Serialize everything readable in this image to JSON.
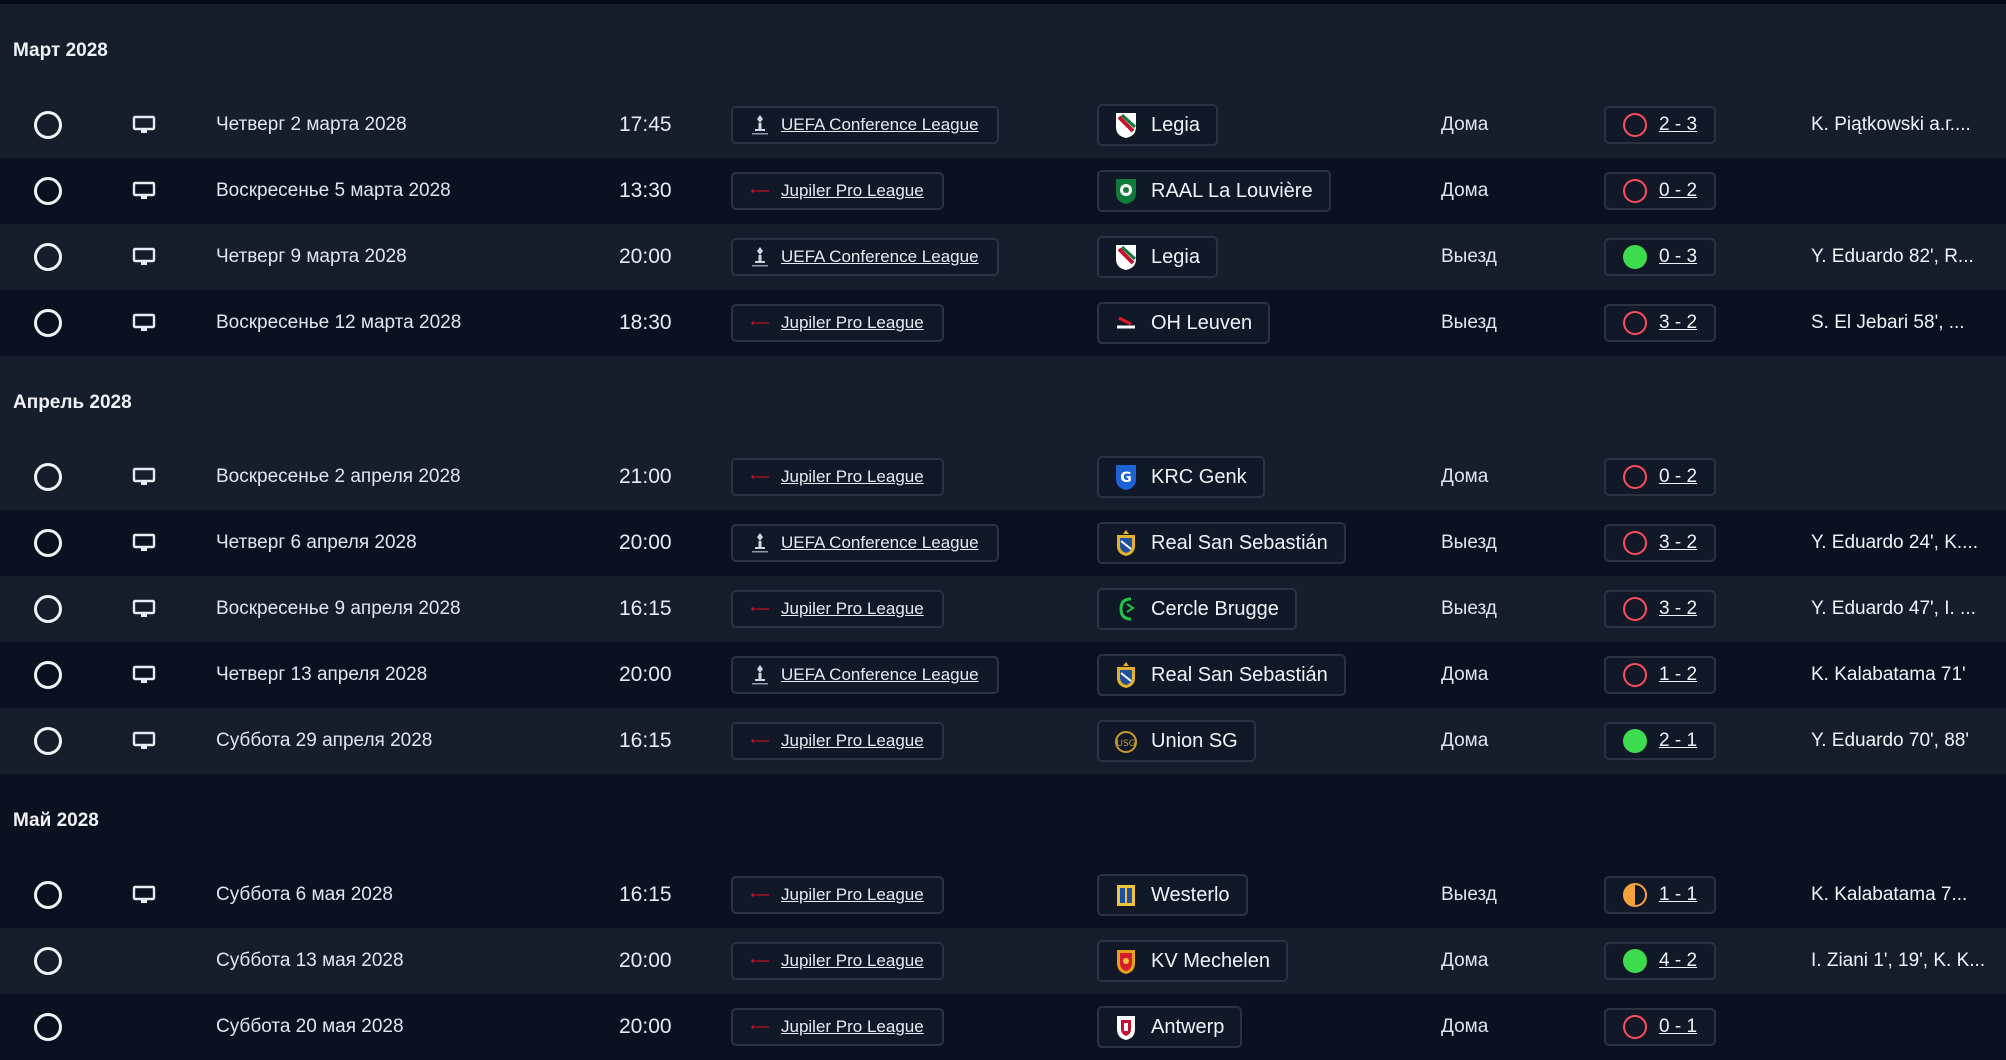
{
  "colors": {
    "win": "#3ddc4f",
    "loss": "#ff4d5e",
    "draw": "#f6a23c",
    "row_dark": "#0b1120",
    "row_light": "#161d2b"
  },
  "months": [
    {
      "title": "Март 2028",
      "matches": [
        {
          "date": "Четверг 2 марта 2028",
          "time": "17:45",
          "competition": "UEFA Conference League",
          "comp_icon": "conference-league-logo-icon",
          "team": "Legia",
          "team_icon": "legia-crest-icon",
          "venue": "Дома",
          "result": "loss",
          "score": "2 - 3",
          "scorers": "K. Piątkowski a.г....",
          "tv": true
        },
        {
          "date": "Воскресенье 5 марта 2028",
          "time": "13:30",
          "competition": "Jupiler Pro League",
          "comp_icon": "jupiler-pro-league-logo-icon",
          "team": "RAAL La Louvière",
          "team_icon": "raal-crest-icon",
          "venue": "Дома",
          "result": "loss",
          "score": "0 - 2",
          "scorers": "",
          "tv": true
        },
        {
          "date": "Четверг 9 марта 2028",
          "time": "20:00",
          "competition": "UEFA Conference League",
          "comp_icon": "conference-league-logo-icon",
          "team": "Legia",
          "team_icon": "legia-crest-icon",
          "venue": "Выезд",
          "result": "win",
          "score": "0 - 3",
          "scorers": "Y. Eduardo 82', R...",
          "tv": true
        },
        {
          "date": "Воскресенье 12 марта 2028",
          "time": "18:30",
          "competition": "Jupiler Pro League",
          "comp_icon": "jupiler-pro-league-logo-icon",
          "team": "OH Leuven",
          "team_icon": "oh-leuven-crest-icon",
          "venue": "Выезд",
          "result": "loss",
          "score": "3 - 2",
          "scorers": "S. El Jebari 58', ...",
          "tv": true
        }
      ]
    },
    {
      "title": "Апрель 2028",
      "matches": [
        {
          "date": "Воскресенье 2 апреля 2028",
          "time": "21:00",
          "competition": "Jupiler Pro League",
          "comp_icon": "jupiler-pro-league-logo-icon",
          "team": "KRC Genk",
          "team_icon": "krc-genk-crest-icon",
          "venue": "Дома",
          "result": "loss",
          "score": "0 - 2",
          "scorers": "",
          "tv": true
        },
        {
          "date": "Четверг 6 апреля 2028",
          "time": "20:00",
          "competition": "UEFA Conference League",
          "comp_icon": "conference-league-logo-icon",
          "team": "Real San Sebastián",
          "team_icon": "real-san-sebastian-crest-icon",
          "venue": "Выезд",
          "result": "loss",
          "score": "3 - 2",
          "scorers": "Y. Eduardo 24', K....",
          "tv": true
        },
        {
          "date": "Воскресенье 9 апреля 2028",
          "time": "16:15",
          "competition": "Jupiler Pro League",
          "comp_icon": "jupiler-pro-league-logo-icon",
          "team": "Cercle Brugge",
          "team_icon": "cercle-brugge-crest-icon",
          "venue": "Выезд",
          "result": "loss",
          "score": "3 - 2",
          "scorers": "Y. Eduardo 47', I. ...",
          "tv": true
        },
        {
          "date": "Четверг 13 апреля 2028",
          "time": "20:00",
          "competition": "UEFA Conference League",
          "comp_icon": "conference-league-logo-icon",
          "team": "Real San Sebastián",
          "team_icon": "real-san-sebastian-crest-icon",
          "venue": "Дома",
          "result": "loss",
          "score": "1 - 2",
          "scorers": "K. Kalabatama 71'",
          "tv": true
        },
        {
          "date": "Суббота 29 апреля 2028",
          "time": "16:15",
          "competition": "Jupiler Pro League",
          "comp_icon": "jupiler-pro-league-logo-icon",
          "team": "Union SG",
          "team_icon": "union-sg-crest-icon",
          "venue": "Дома",
          "result": "win",
          "score": "2 - 1",
          "scorers": "Y. Eduardo 70', 88'",
          "tv": true
        }
      ]
    },
    {
      "title": "Май 2028",
      "matches": [
        {
          "date": "Суббота 6 мая 2028",
          "time": "16:15",
          "competition": "Jupiler Pro League",
          "comp_icon": "jupiler-pro-league-logo-icon",
          "team": "Westerlo",
          "team_icon": "westerlo-crest-icon",
          "venue": "Выезд",
          "result": "draw",
          "score": "1 - 1",
          "scorers": "K. Kalabatama 7...",
          "tv": true
        },
        {
          "date": "Суббота 13 мая 2028",
          "time": "20:00",
          "competition": "Jupiler Pro League",
          "comp_icon": "jupiler-pro-league-logo-icon",
          "team": "KV Mechelen",
          "team_icon": "kv-mechelen-crest-icon",
          "venue": "Дома",
          "result": "win",
          "score": "4 - 2",
          "scorers": "I. Ziani 1', 19', K. K...",
          "tv": false
        },
        {
          "date": "Суббота 20 мая 2028",
          "time": "20:00",
          "competition": "Jupiler Pro League",
          "comp_icon": "jupiler-pro-league-logo-icon",
          "team": "Antwerp",
          "team_icon": "antwerp-crest-icon",
          "venue": "Дома",
          "result": "loss",
          "score": "0 - 1",
          "scorers": "",
          "tv": false
        }
      ]
    }
  ]
}
